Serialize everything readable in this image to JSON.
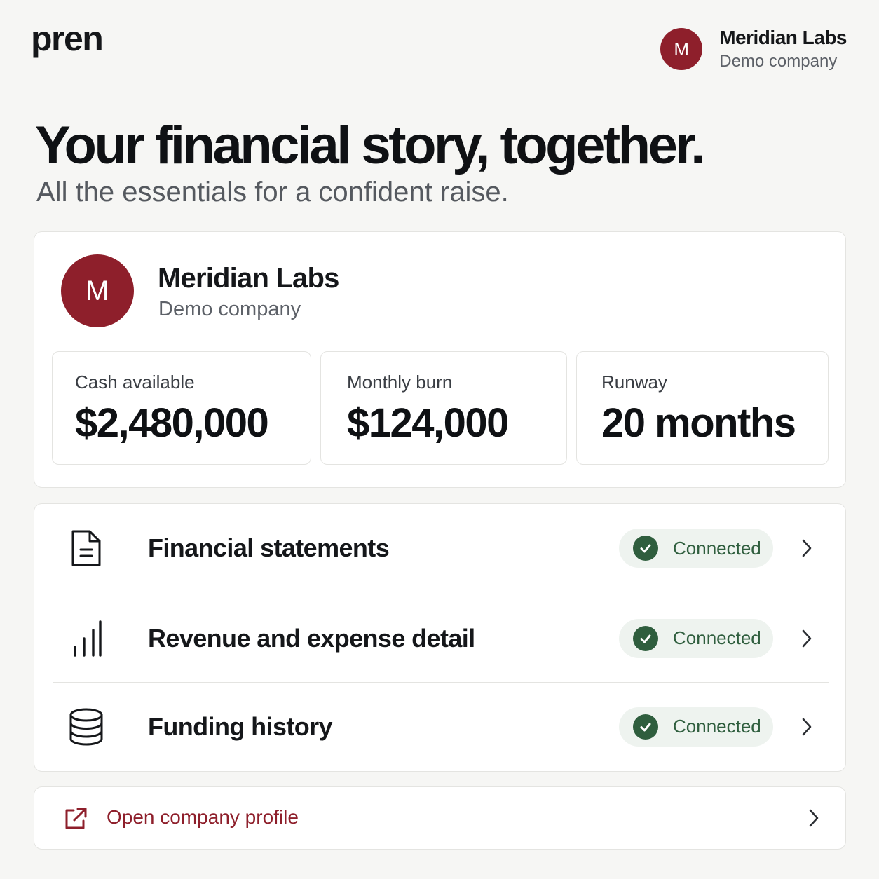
{
  "app": {
    "logo": "pren"
  },
  "account": {
    "initial": "M",
    "name": "Meridian Labs",
    "subtitle": "Demo company"
  },
  "hero": {
    "title": "Your financial story, together.",
    "subtitle": "All the essentials for a confident raise."
  },
  "company": {
    "initial": "M",
    "name": "Meridian Labs",
    "subtitle": "Demo company",
    "stats": [
      {
        "label": "Cash available",
        "value": "$2,480,000"
      },
      {
        "label": "Monthly burn",
        "value": "$124,000"
      },
      {
        "label": "Runway",
        "value": "20 months"
      }
    ]
  },
  "sources": [
    {
      "label": "Financial statements",
      "status": "Connected",
      "icon": "document-icon"
    },
    {
      "label": "Revenue and expense detail",
      "status": "Connected",
      "icon": "bar-chart-icon"
    },
    {
      "label": "Funding history",
      "status": "Connected",
      "icon": "database-icon"
    }
  ],
  "profile_link": {
    "label": "Open company profile",
    "icon": "external-link-icon"
  },
  "colors": {
    "brand": "#8e1f2b",
    "status_connected": "#2f5e3e",
    "status_bg": "#eef3ef",
    "page_bg": "#f6f6f4"
  }
}
